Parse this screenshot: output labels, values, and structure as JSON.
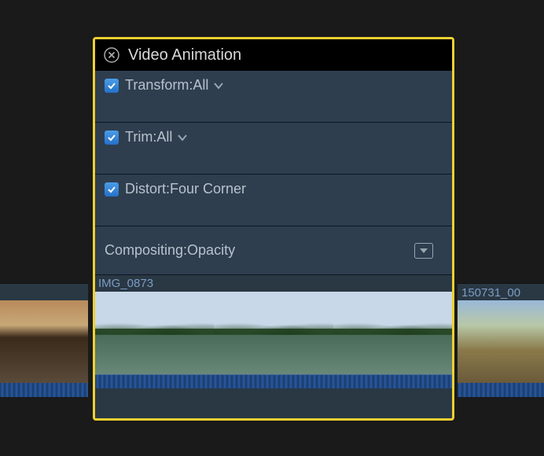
{
  "header": {
    "title": "Video Animation"
  },
  "effects": [
    {
      "label": "Transform:All",
      "checked": true,
      "has_disclosure": true
    },
    {
      "label": "Trim:All",
      "checked": true,
      "has_disclosure": true
    },
    {
      "label": "Distort:Four Corner",
      "checked": true,
      "has_disclosure": false
    }
  ],
  "compositing": {
    "label": "Compositing:Opacity"
  },
  "clip": {
    "name": "IMG_0873"
  },
  "left_clip": {
    "name": ""
  },
  "right_clip": {
    "name": "150731_00"
  }
}
